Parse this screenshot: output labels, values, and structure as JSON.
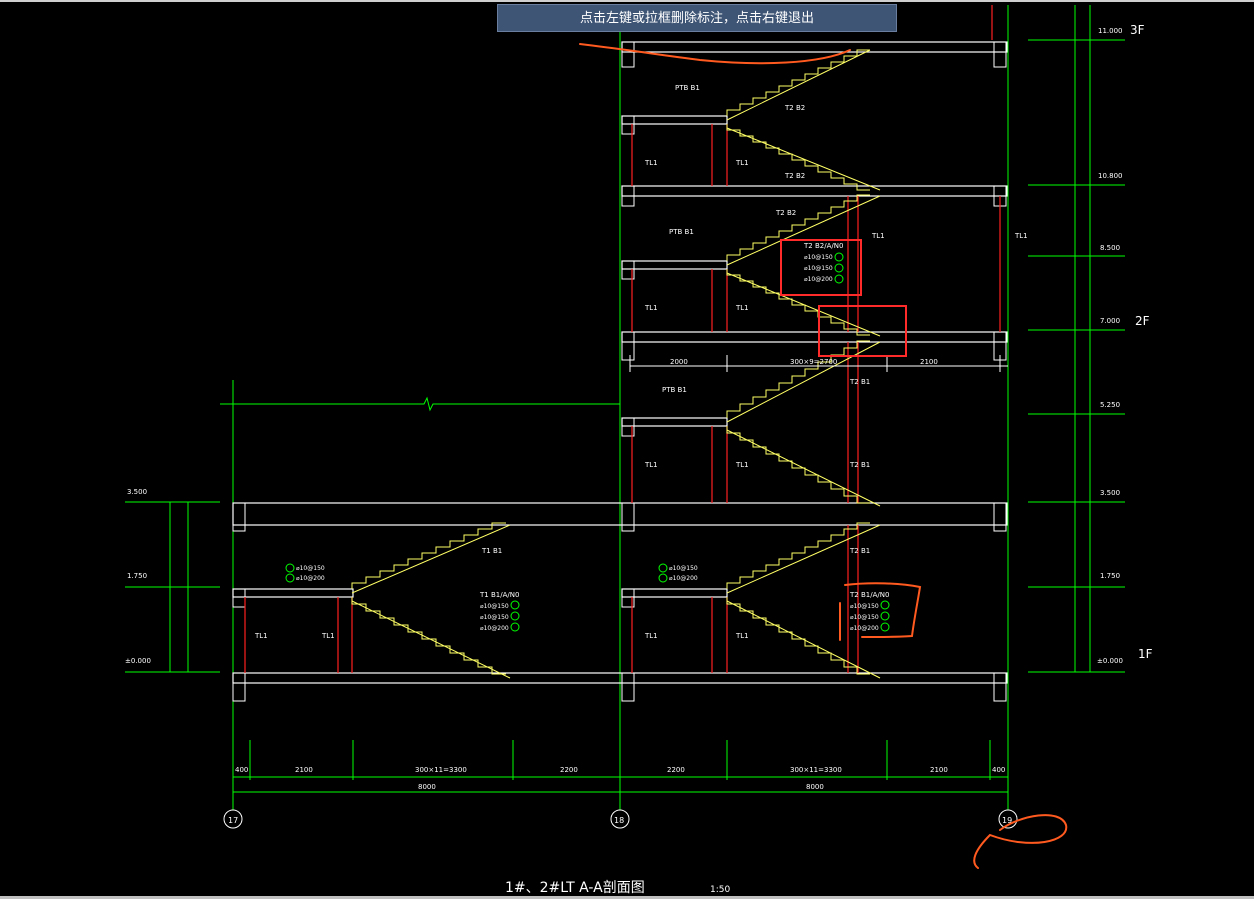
{
  "tooltip": "点击左键或拉框删除标注，点击右键退出",
  "title": "1#、2#LT A-A剖面图",
  "scale": "1:50",
  "floors": [
    "3F",
    "2F",
    "1F"
  ],
  "elevations_right": [
    "11.000",
    "10.800",
    "8.500",
    "7.000",
    "5.250",
    "3.500",
    "1.750",
    "±0.000"
  ],
  "elevations_left": [
    "3.500",
    "1.750",
    "±0.000"
  ],
  "dims_top": [
    "2000",
    "300×9=2700",
    "2100"
  ],
  "dims_bottom_row1": [
    "400",
    "2100",
    "300×11=3300",
    "2200",
    "2200",
    "300×11=3300",
    "2100",
    "400"
  ],
  "dims_bottom_row2": [
    "8000",
    "8000"
  ],
  "axes": [
    "17",
    "18",
    "19"
  ],
  "labels": {
    "tl": "TL1",
    "pb": "PTB B1",
    "t1b1": "T1 B1",
    "t2b1": "T2 B1",
    "t2b2": "T2 B2",
    "t1b1_note": "T1 B1/A/N0",
    "t2b1_note": "T2 B1/A/N0",
    "t2b2_note": "T2 B2/A/N0",
    "bar1": "⌀10@150",
    "bar2": "⌀10@150",
    "bar3": "⌀10@200"
  },
  "colors": {
    "background": "#000000",
    "structure": "#ffffff",
    "stairs": "#ffff66",
    "dimension": "#00ff00",
    "wall_red": "#ff2020",
    "annotation": "#ff5a1f",
    "highlight_box": "#ff2a2a",
    "tooltip_bg": "#3f5576"
  }
}
